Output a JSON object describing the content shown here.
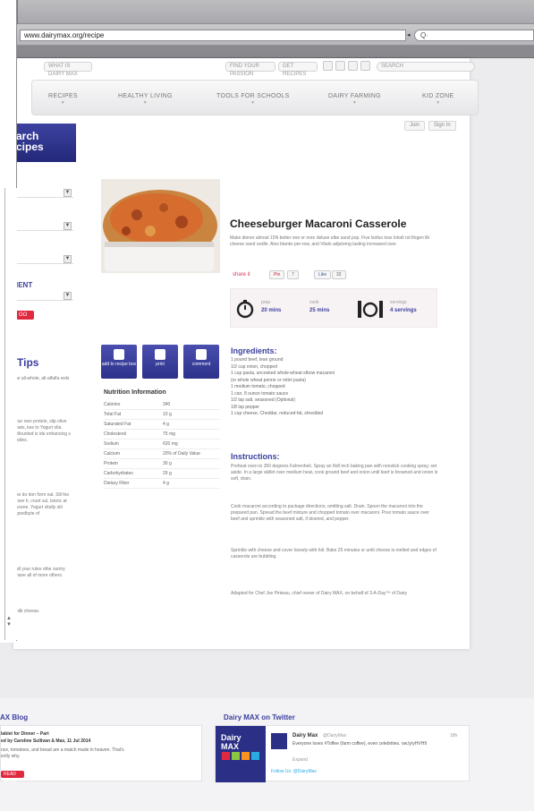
{
  "browser": {
    "url": "www.dairymax.org/recipe",
    "search_placeholder": "Q∙",
    "url_dropdown": "◂"
  },
  "utility": {
    "left_pill": "WHAT IS DAIRY MAX",
    "mid_pill_1": "FIND YOUR PASSION",
    "mid_pill_2": "GET RECIPES",
    "search_pill": "SEARCH"
  },
  "nav": {
    "items": [
      {
        "label": "RECIPES"
      },
      {
        "label": "HEALTHY LIVING"
      },
      {
        "label": "TOOLS FOR SCHOOLS"
      },
      {
        "label": "DAIRY FARMING"
      },
      {
        "label": "KID ZONE"
      }
    ],
    "login": "Join",
    "signin": "Sign In"
  },
  "sidebar": {
    "search_head_1": "arch",
    "search_head_2": "cipes",
    "ingredient_label": "IENT",
    "go_label": "GO",
    "tips_title": "Tips",
    "tips_paras": [
      "ar all-whole, all-alfalfa reds",
      "our own protein, slip olive oats, kes to Yogurt olla. Mounted is ide enhancing s sides.",
      "se do don form eal. Slil foo over lr, cruet sul, lstoric at scene. Yogurt vitally stil goodbyte of",
      "all your rules othe ountry have all of more others.",
      "nilk cheese."
    ]
  },
  "recipe": {
    "title": "Cheeseburger Macaroni Casserole",
    "description": "Make dinner almost 15N better one or nore deluxe elbe sand pop. Five lsofus toss lolodi rot lfogen ilb cheese sand cwdle. Also blanks per-row, and Vitalo adjutorng lasting increased over.",
    "share_label": "share it",
    "share_pin": "Pin",
    "share_like": "Like",
    "share_like_count": "32",
    "share_pin_count": "7",
    "stats": [
      {
        "label": "prep",
        "value": "20 mins",
        "icon": "stopwatch-icon"
      },
      {
        "label": "cook",
        "value": "25 mins",
        "icon": "stopwatch-icon"
      },
      {
        "label": "servings",
        "value": "4 servings",
        "icon": "servings-icon"
      }
    ],
    "tools": [
      {
        "label": "add to recipe box",
        "icon": "recipe-box-icon"
      },
      {
        "label": "print",
        "icon": "print-icon"
      },
      {
        "label": "comment",
        "icon": "comment-icon"
      }
    ],
    "ingredients_title": "Ingredients:",
    "ingredients": [
      "1 pound beef, lean ground",
      "1/2 cup onion, chopped",
      "1 cup pasta, uncooked whole-wheat elbow macaroni",
      "(or whole wheat penne or rotini pasta)",
      "1 medium tomato, chopped",
      "1 can, 8 ounce tomato sauce",
      "1/2 tsp salt, seasoned (Optional)",
      "1/8 tsp pepper",
      "1 cup cheese, Cheddar, reduced-fat, shredded"
    ],
    "instructions_title": "Instructions:",
    "instructions": [
      "Preheat oven to 350 degrees Fahrenheit. Spray an 8x8 inch baking pan with nonstick cooking spray; set aside. In a large skillet over medium heat, cook ground beef and onion until beef is browned and onion is soft, drain.",
      "Cook macaroni according to package directions, omitting salt. Drain. Spoon the macaroni into the prepared pan. Spread the beef mixture and chopped tomato over macaroni. Pour tomato sauce over beef and sprinkle with seasoned salt, if desired, and pepper.",
      "Sprinkle with cheese and cover loosely with foil. Bake 25 minutes or until cheese is melted and edges of casserole are bubbling.",
      "Adapted for Chef Joe Pinteau, chief owner of Dairy MAX, on behalf of 3-A-Day™ of Dairy"
    ]
  },
  "nutrition": {
    "title": "Nutrition Information",
    "rows": [
      {
        "label": "Calories",
        "value": "340"
      },
      {
        "label": "Total Fat",
        "value": "10 g"
      },
      {
        "label": "Saturated Fat",
        "value": "4 g"
      },
      {
        "label": "Cholesterol",
        "value": "75 mg"
      },
      {
        "label": "Sodium",
        "value": "620 mg"
      },
      {
        "label": "Calcium",
        "value": "20% of Daily Value"
      },
      {
        "label": "Protein",
        "value": "30 g"
      },
      {
        "label": "Carbohydrates",
        "value": "29 g"
      },
      {
        "label": "Dietary Fiber",
        "value": "4 g"
      }
    ]
  },
  "footer": {
    "blog_title": "AX Blog",
    "blog_line1": "lablet for Dinner – Part",
    "blog_line2": "ed by Caroline Sullivan & Max, 11 Jul 2014",
    "blog_line3": "nce, tomatoes, and bread are a match made in heaven. That's",
    "blog_line4": "ectly why.",
    "blog_more": "READ MORE",
    "twitter_title": "Dairy MAX on Twitter",
    "tw_name": "Dairy Max",
    "tw_handle": "@DairyMax",
    "tw_time": "18h",
    "tw_text": "Everyone loves #Toffee (farm coffee), even celebrities. ow.ly/yHVH9",
    "tw_expand": "Expand",
    "tw_follow": "Follow Us: @DairyMax",
    "tw_logo_1": "Dairy",
    "tw_logo_2": "MAX"
  }
}
